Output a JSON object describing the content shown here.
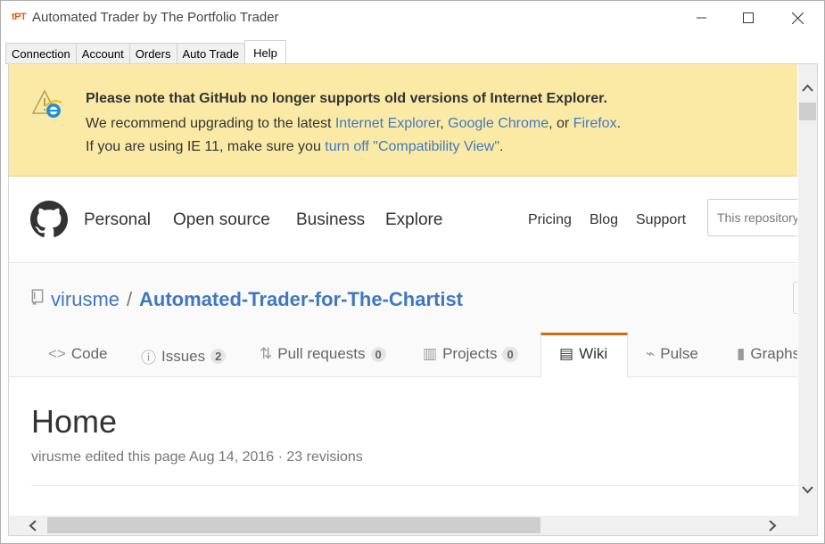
{
  "window": {
    "logo_text": "tPT",
    "title": "Automated Trader by The Portfolio Trader"
  },
  "tabs": [
    {
      "label": "Connection",
      "active": false
    },
    {
      "label": "Account",
      "active": false
    },
    {
      "label": "Orders",
      "active": false
    },
    {
      "label": "Auto Trade",
      "active": false
    },
    {
      "label": "Help",
      "active": true
    }
  ],
  "banner": {
    "line1": "Please note that GitHub no longer supports old versions of Internet Explorer.",
    "line2_pre": "We recommend upgrading to the latest ",
    "link_ie": "Internet Explorer",
    "sep1": ", ",
    "link_chrome": "Google Chrome",
    "sep2": ", or ",
    "link_firefox": "Firefox",
    "line2_end": ".",
    "line3_pre": "If you are using IE 11, make sure you ",
    "link_compat": "turn off \"Compatibility View\"",
    "line3_end": "."
  },
  "gh_nav": {
    "personal": "Personal",
    "open_source": "Open source",
    "business": "Business",
    "explore": "Explore",
    "pricing": "Pricing",
    "blog": "Blog",
    "support": "Support",
    "search_placeholder": "This repository"
  },
  "repo": {
    "owner": "virusme",
    "separator": "/",
    "name": "Automated-Trader-for-The-Chartist"
  },
  "repo_nav": {
    "code": "Code",
    "issues": "Issues",
    "issues_count": "2",
    "pull_requests": "Pull requests",
    "pull_requests_count": "0",
    "projects": "Projects",
    "projects_count": "0",
    "wiki": "Wiki",
    "pulse": "Pulse",
    "graphs": "Graphs"
  },
  "page": {
    "title": "Home",
    "meta": "virusme edited this page Aug 14, 2016 · 23 revisions"
  },
  "colors": {
    "banner_bg": "#fbeaa6",
    "link": "#4078c0",
    "wiki_accent": "#d26911"
  }
}
